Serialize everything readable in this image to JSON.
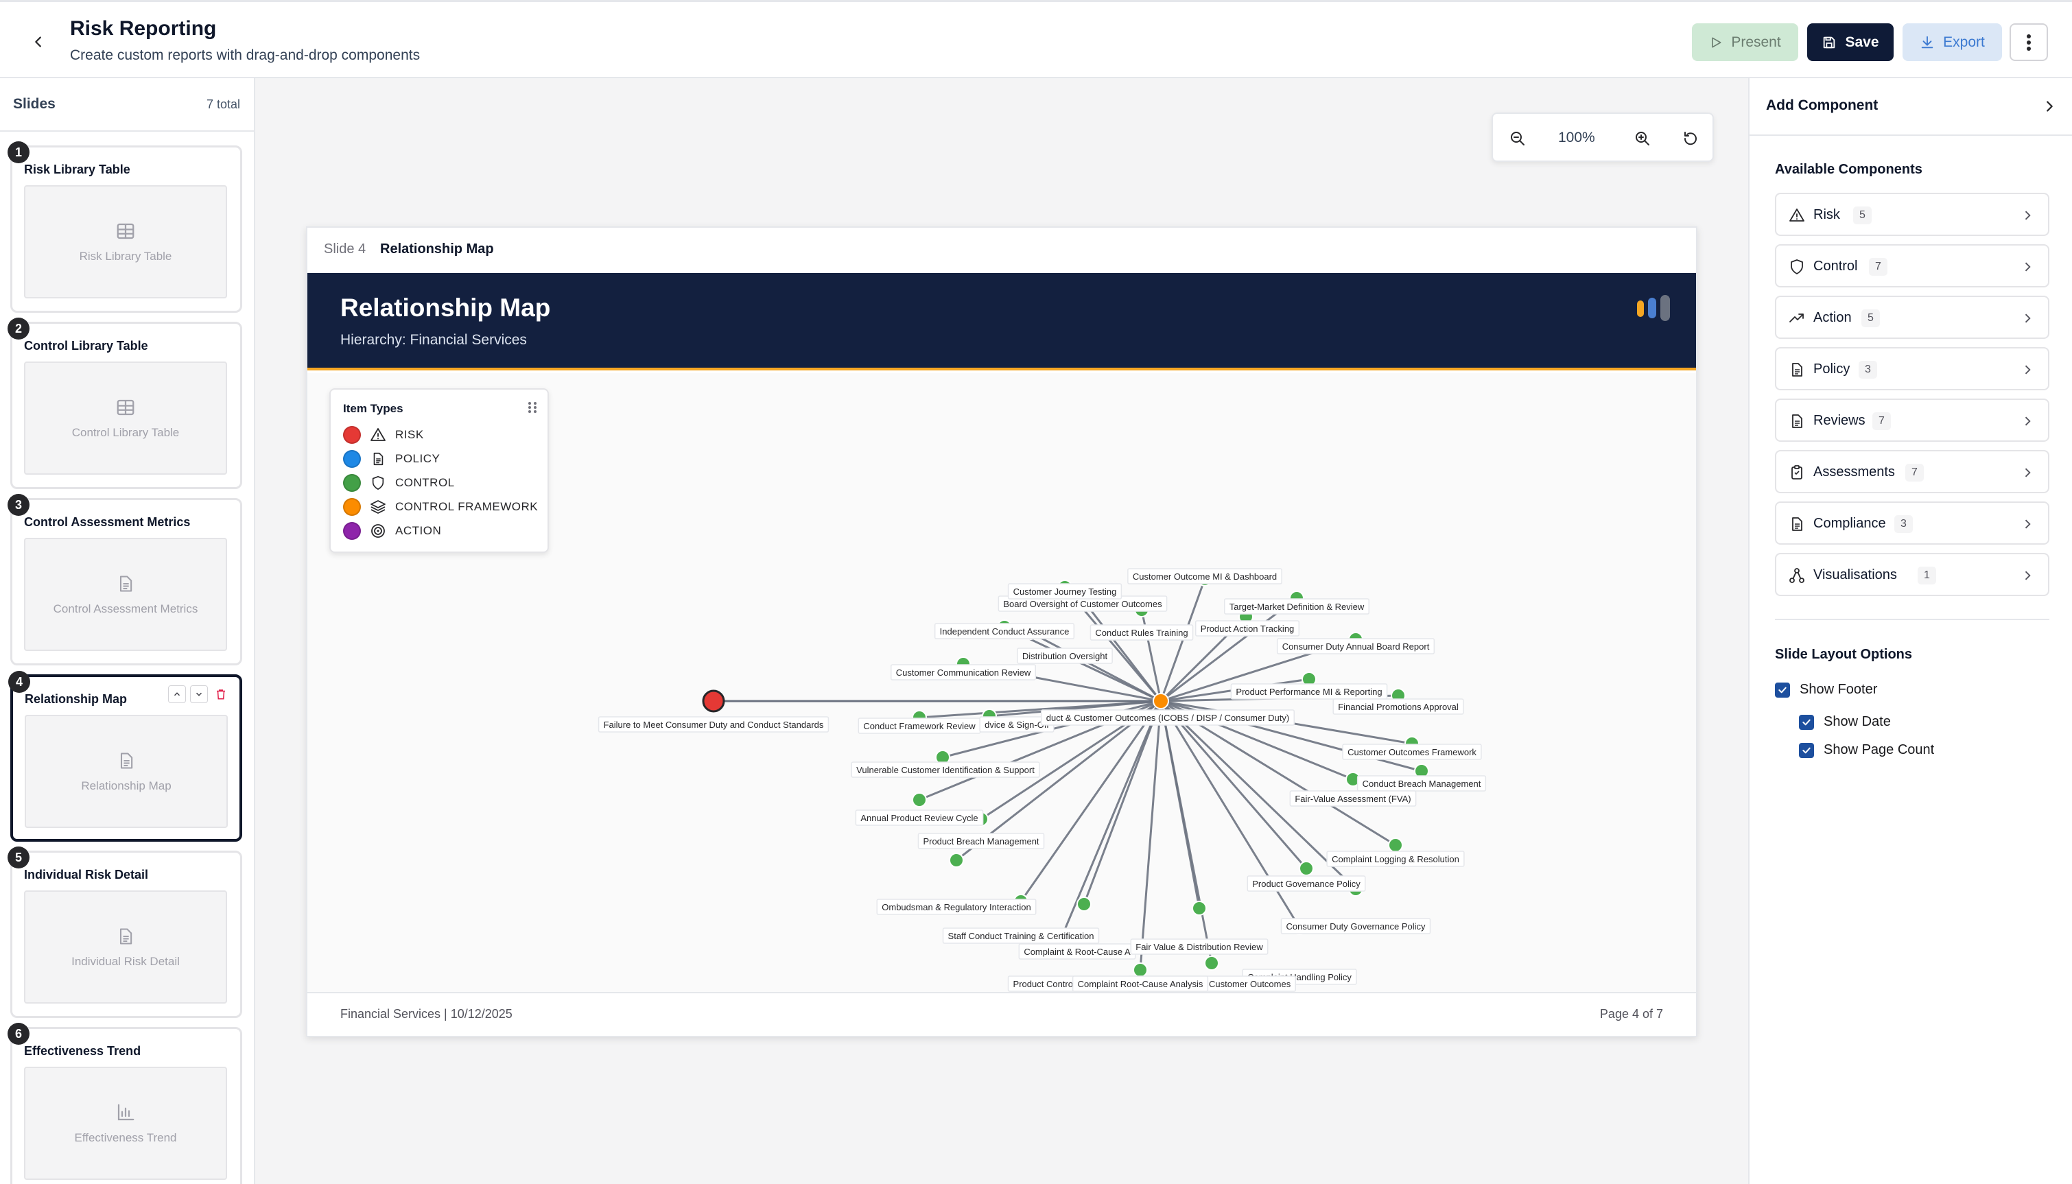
{
  "header": {
    "title": "Risk Reporting",
    "subtitle": "Create custom reports with drag-and-drop components",
    "present_label": "Present",
    "save_label": "Save",
    "export_label": "Export"
  },
  "sidebar": {
    "title": "Slides",
    "count": "7 total",
    "slides": [
      {
        "num": "1",
        "label": "Risk Library Table",
        "thumb": "Risk Library Table",
        "icon": "table-icon"
      },
      {
        "num": "2",
        "label": "Control Library Table",
        "thumb": "Control Library Table",
        "icon": "table-icon"
      },
      {
        "num": "3",
        "label": "Control Assessment Metrics",
        "thumb": "Control Assessment Metrics",
        "icon": "document-icon"
      },
      {
        "num": "4",
        "label": "Relationship Map",
        "thumb": "Relationship Map",
        "icon": "document-icon"
      },
      {
        "num": "5",
        "label": "Individual Risk Detail",
        "thumb": "Individual Risk Detail",
        "icon": "document-icon"
      },
      {
        "num": "6",
        "label": "Effectiveness Trend",
        "thumb": "Effectiveness Trend",
        "icon": "bar-chart-icon"
      }
    ]
  },
  "canvas": {
    "zoom": "100%",
    "slide_no": "Slide 4",
    "slide_name": "Relationship Map",
    "banner_title": "Relationship Map",
    "banner_subtitle": "Hierarchy: Financial Services",
    "footer_left": "Financial Services | 10/12/2025",
    "footer_right": "Page 4 of 7",
    "legend": {
      "title": "Item Types",
      "items": [
        {
          "label": "RISK",
          "color": "#e53935",
          "icon": "warning-icon"
        },
        {
          "label": "POLICY",
          "color": "#1e88e5",
          "icon": "document-icon"
        },
        {
          "label": "CONTROL",
          "color": "#43a047",
          "icon": "shield-icon"
        },
        {
          "label": "CONTROL FRAMEWORK",
          "color": "#fb8c00",
          "icon": "layers-icon"
        },
        {
          "label": "ACTION",
          "color": "#8e24aa",
          "icon": "target-icon"
        }
      ]
    },
    "graph": {
      "hub_label": "duct & Customer Outcomes (ICOBS / DISP / Consumer Duty)",
      "risk_label": "Failure to Meet Consumer Duty and Conduct Standards",
      "labels": [
        "Board Oversight of Customer Outcomes",
        "Customer Outcome MI & Dashboard",
        "Customer Journey Testing",
        "Target-Market Definition & Review",
        "Independent Conduct Assurance",
        "Conduct Rules Training",
        "Product Action Tracking",
        "Consumer Duty Annual Board Report",
        "Distribution Oversight",
        "Customer Communication Review",
        "Product Performance MI & Reporting",
        "Financial Promotions Approval",
        "Conduct Framework Review",
        "dvice & Sign-Off",
        "Customer Outcomes Framework",
        "Vulnerable Customer Identification & Support",
        "Conduct Breach Management",
        "Fair-Value Assessment (FVA)",
        "Annual Product Review Cycle",
        "Product Breach Management",
        "Complaint Logging & Resolution",
        "Product Governance Policy",
        "Ombudsman & Regulatory Interaction",
        "Consumer Duty Governance Policy",
        "Staff Conduct Training & Certification",
        "Complaint & Root-Cause A",
        "Fair Value & Distribution Review",
        "Complaint Handling Policy",
        "Product Control Testing",
        "Action Tracking for Customer Outcomes",
        "Complaint Root-Cause Analysis"
      ]
    }
  },
  "rpanel": {
    "title": "Add Component",
    "available_title": "Available Components",
    "components": [
      {
        "label": "Risk",
        "count": "5",
        "icon": "warning-icon"
      },
      {
        "label": "Control",
        "count": "7",
        "icon": "shield-icon"
      },
      {
        "label": "Action",
        "count": "5",
        "icon": "trend-icon"
      },
      {
        "label": "Policy",
        "count": "3",
        "icon": "document-icon"
      },
      {
        "label": "Reviews",
        "count": "7",
        "icon": "document-icon"
      },
      {
        "label": "Assessments",
        "count": "7",
        "icon": "clipboard-icon"
      },
      {
        "label": "Compliance",
        "count": "3",
        "icon": "document-icon"
      },
      {
        "label": "Visualisations",
        "count": "1",
        "icon": "network-icon"
      }
    ],
    "layout_title": "Slide Layout Options",
    "show_footer": "Show Footer",
    "show_date": "Show Date",
    "show_page_count": "Show Page Count"
  },
  "colors": {
    "banner": "#13203f",
    "accent": "#f5a623",
    "control_node": "#4caf50",
    "hub_node": "#fb8c00",
    "risk_node": "#e53935",
    "edge": "#6b7280"
  }
}
